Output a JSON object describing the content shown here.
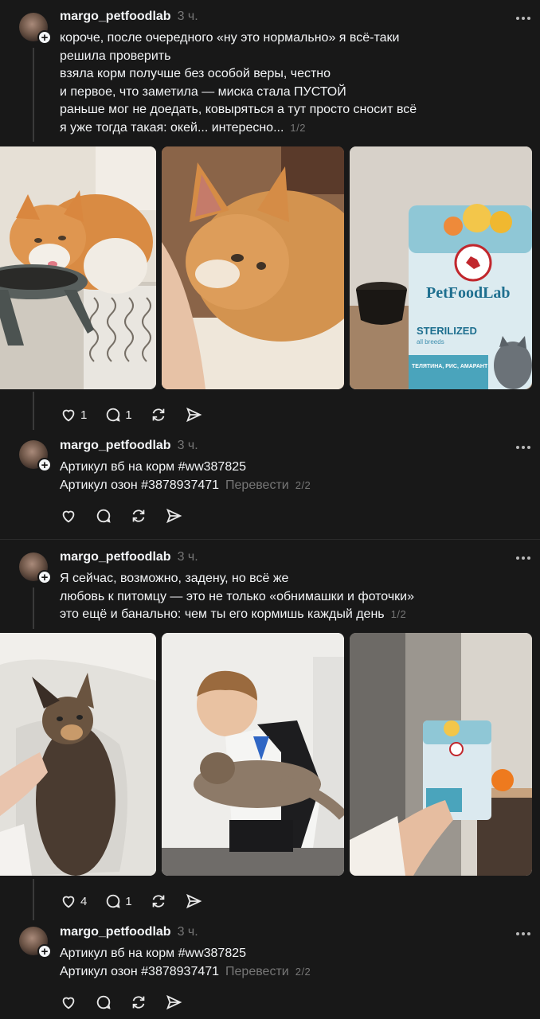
{
  "posts": [
    {
      "username": "margo_petfoodlab",
      "time": "3 ч.",
      "lines": [
        "короче, после очередного «ну это нормально» я всё-таки",
        "решила проверить",
        "взяла корм получше без особой веры, честно",
        "и первое, что заметила — миска стала ПУСТОЙ",
        "раньше мог не доедать, ковыряться а тут просто сносит всё",
        "я уже тогда такая: окей... интересно..."
      ],
      "pager": "1/2",
      "likes": "1",
      "comments": "1"
    },
    {
      "username": "margo_petfoodlab",
      "time": "3 ч.",
      "lines": [
        "Артикул вб на корм #ww387825",
        "Артикул озон #3878937471"
      ],
      "translate": "Перевести",
      "pager": "2/2"
    },
    {
      "username": "margo_petfoodlab",
      "time": "3 ч.",
      "lines": [
        "Я сейчас, возможно, задену, но всё же",
        "любовь к питомцу — это не только «обнимашки и фоточки»",
        "это ещё и банально: чем ты его кормишь каждый день"
      ],
      "pager": "1/2",
      "likes": "4",
      "comments": "1"
    },
    {
      "username": "margo_petfoodlab",
      "time": "3 ч.",
      "lines": [
        "Артикул вб на корм #ww387825",
        "Артикул озон #3878937471"
      ],
      "translate": "Перевести",
      "pager": "2/2"
    }
  ],
  "photos": {
    "bag_brand": "PetFoodLab",
    "bag_line": "STERILIZED",
    "bag_sub": "all breeds",
    "bag_flavor": "ТЕЛЯТИНА, РИС, АМАРАНТ"
  },
  "colors": {
    "background": "#181818",
    "text": "#f3f5f7",
    "muted": "#777777",
    "thread_line": "#3a3a3a"
  }
}
